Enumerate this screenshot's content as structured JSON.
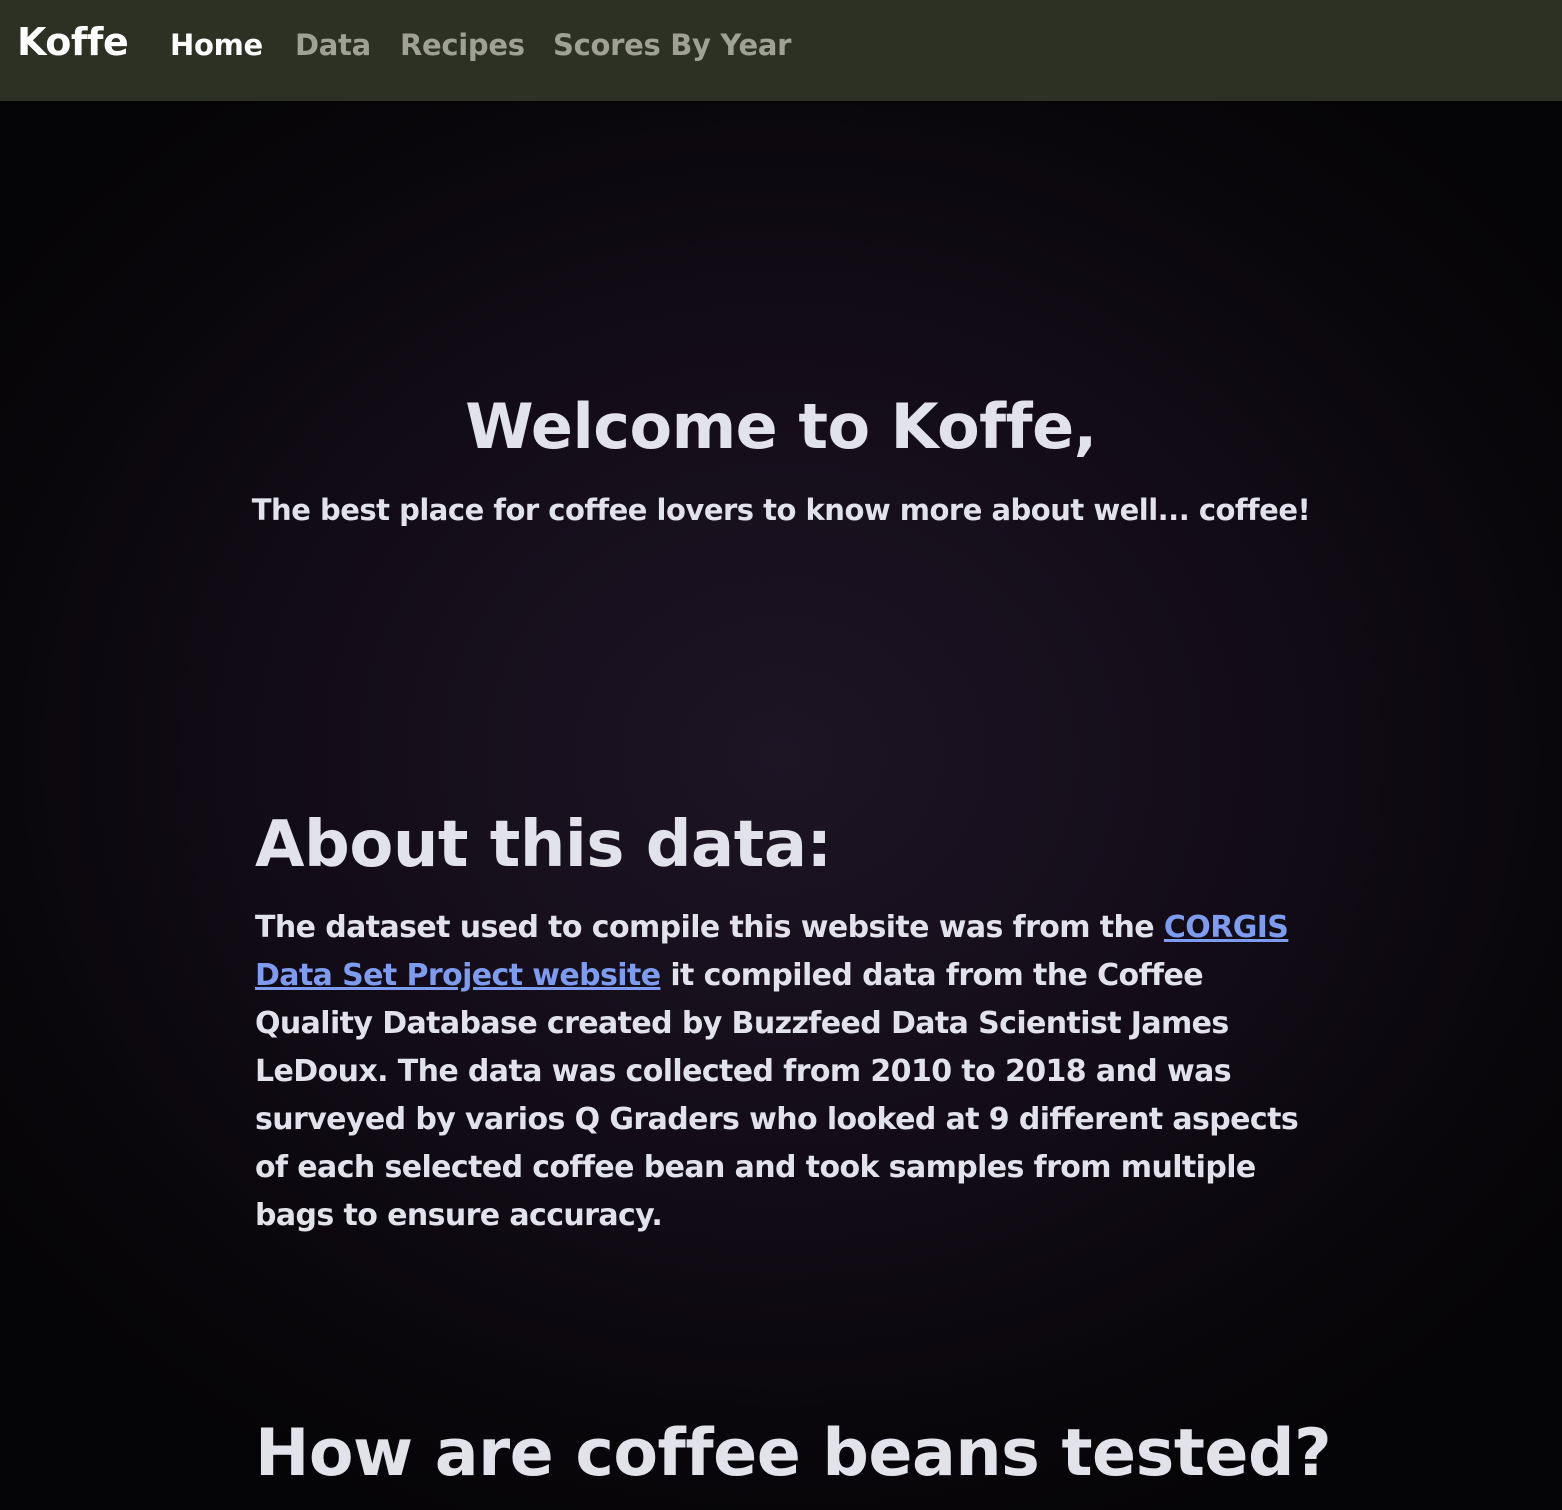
{
  "navbar": {
    "brand": "Koffe",
    "links": [
      {
        "label": "Home",
        "active": true
      },
      {
        "label": "Data",
        "active": false
      },
      {
        "label": "Recipes",
        "active": false
      },
      {
        "label": "Scores By Year",
        "active": false
      }
    ]
  },
  "hero": {
    "title": "Welcome to Koffe,",
    "subtitle": "The best place for coffee lovers to know more about well... coffee!"
  },
  "about": {
    "heading": "About this data:",
    "text_before_link": "The dataset used to compile this website was from the ",
    "link_label": "CORGIS Data Set Project website",
    "text_after_link": " it compiled data from the Coffee Quality Database created by Buzzfeed Data Scientist James LeDoux. The data was collected from 2010 to 2018 and was surveyed by varios Q Graders who looked at 9 different aspects of each selected coffee bean and took samples from multiple bags to ensure accuracy."
  },
  "testing": {
    "heading": "How are coffee beans tested?"
  },
  "colors": {
    "navbar_bg": "#2d3124",
    "page_bg": "#0a070c",
    "text": "#e2e2ea",
    "link": "#7d9cf0",
    "nav_inactive": "#9ea193"
  }
}
